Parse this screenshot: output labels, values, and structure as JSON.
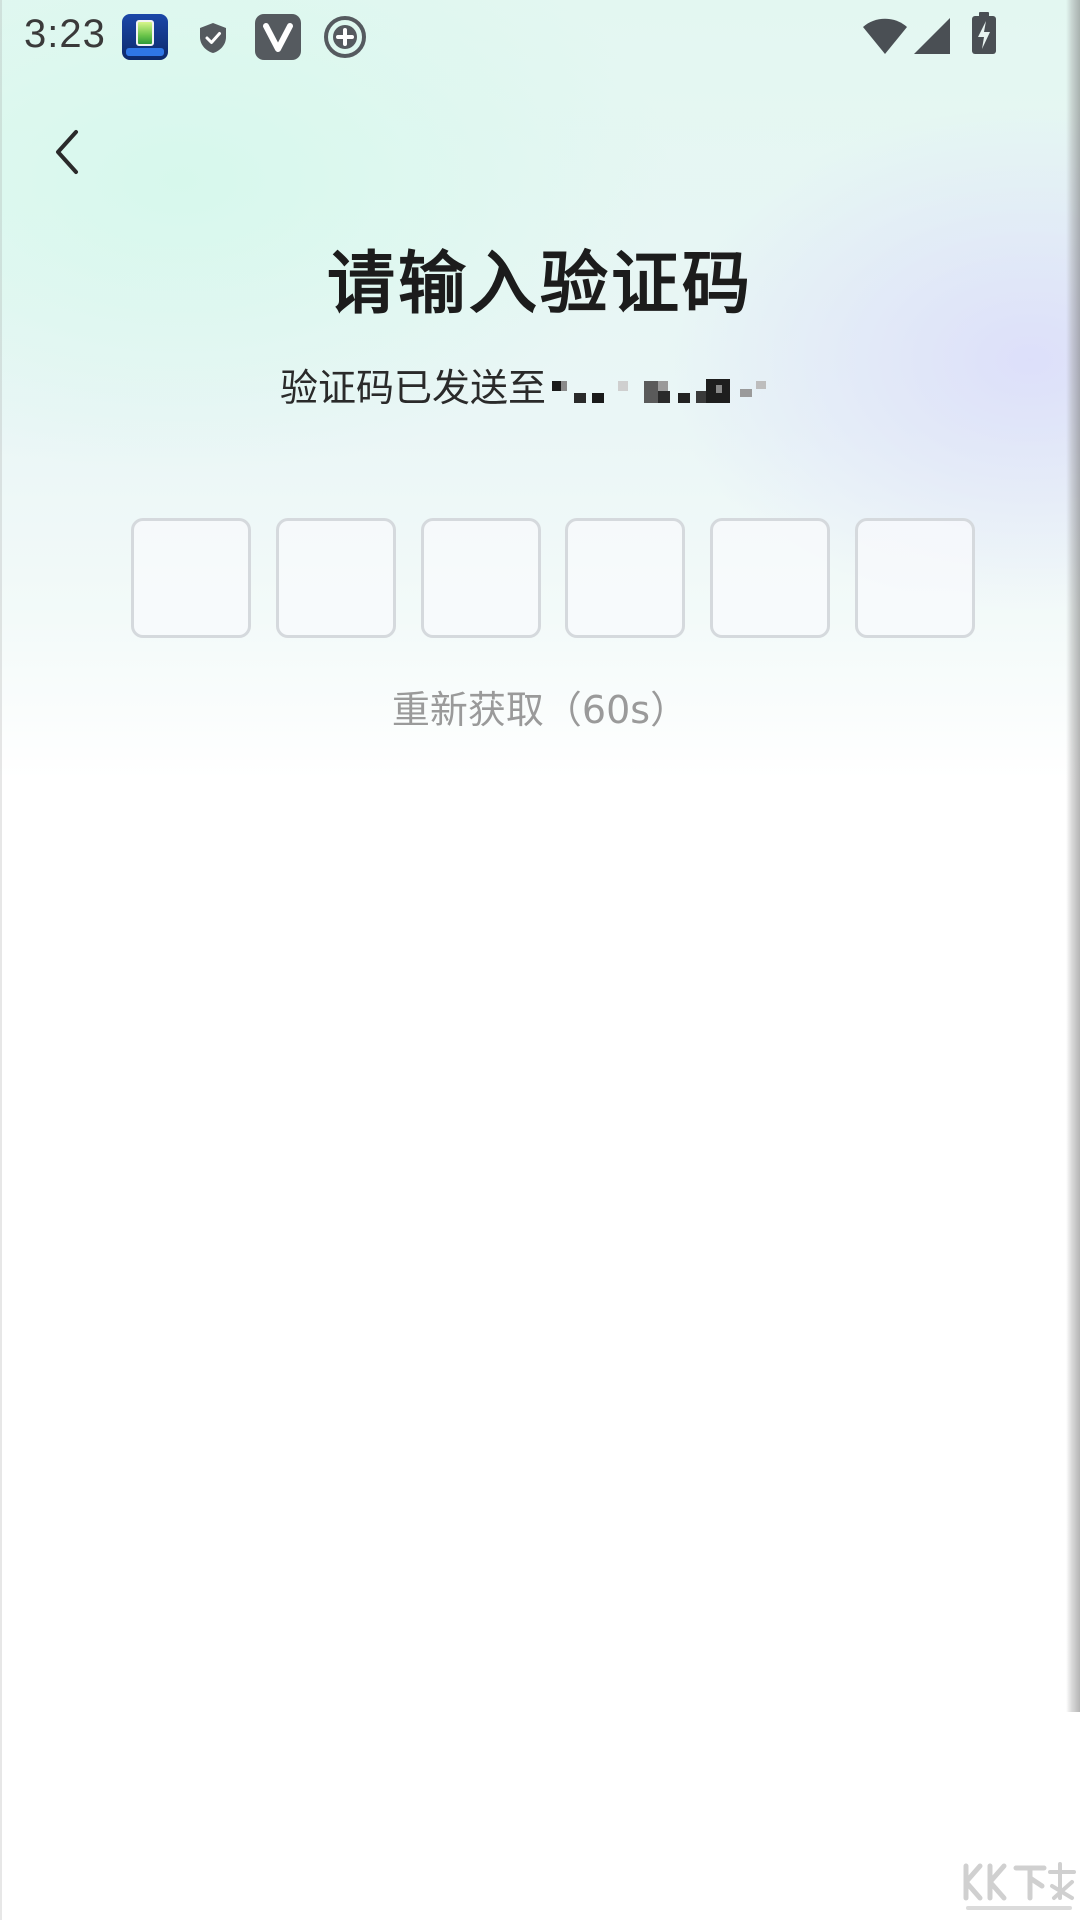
{
  "status_bar": {
    "time": "3:23",
    "icons": [
      "app-battery-icon",
      "shield-icon",
      "v-app-icon",
      "circle-plus-icon",
      "wifi-icon",
      "signal-icon",
      "battery-charging-icon"
    ]
  },
  "header": {
    "back_icon": "chevron-left-icon"
  },
  "page": {
    "title": "请输入验证码",
    "subtitle_prefix": "验证码已发送至",
    "resend_label": "重新获取（60s）"
  },
  "code_input": {
    "length": 6,
    "digits": [
      "",
      "",
      "",
      "",
      "",
      ""
    ]
  },
  "colors": {
    "title": "#1c1c1c",
    "box_border": "#d5d9dd",
    "resend_text": "#9a9a9a",
    "bg_mint": "#e3f7f1",
    "bg_lavender": "#dcdefa"
  }
}
